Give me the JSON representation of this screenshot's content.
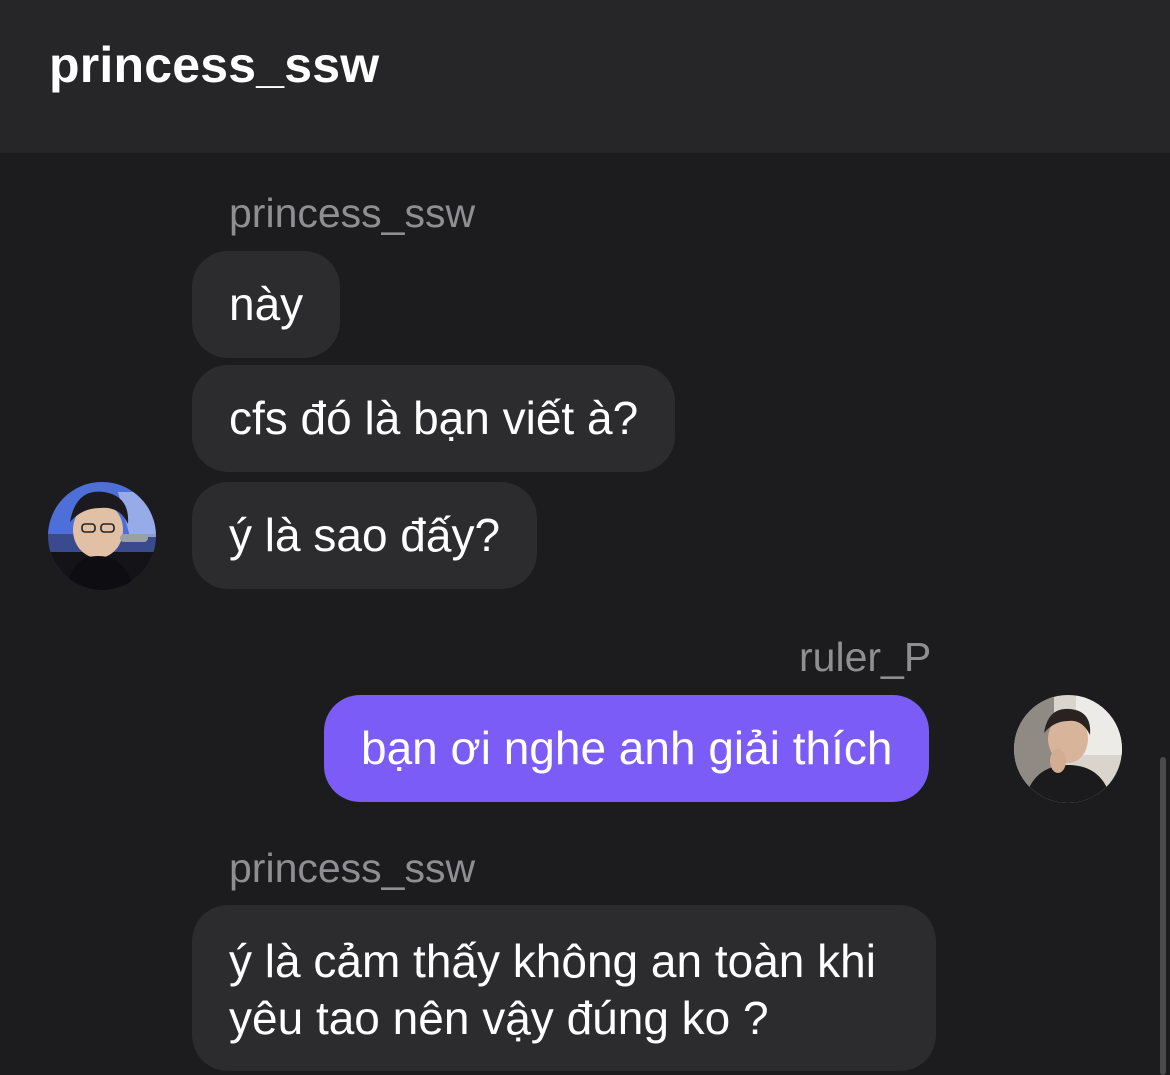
{
  "header": {
    "title": "princess_ssw"
  },
  "messages": [
    {
      "group": "incoming",
      "sender": "princess_ssw",
      "lines": [
        "này",
        "cfs đó là bạn viết à?",
        "ý là sao đấy?"
      ]
    },
    {
      "group": "outgoing",
      "sender": "ruler_P",
      "lines": [
        "bạn ơi nghe anh giải thích"
      ]
    },
    {
      "group": "incoming",
      "sender": "princess_ssw",
      "lines": [
        "ý là cảm thấy không an toàn khi yêu tao nên vậy đúng ko ?"
      ]
    }
  ],
  "colors": {
    "background": "#1c1c1e",
    "header": "#262628",
    "incoming_bubble": "#2c2c2e",
    "outgoing_bubble": "#7c5cf6",
    "sender_text": "#8e8e93"
  }
}
